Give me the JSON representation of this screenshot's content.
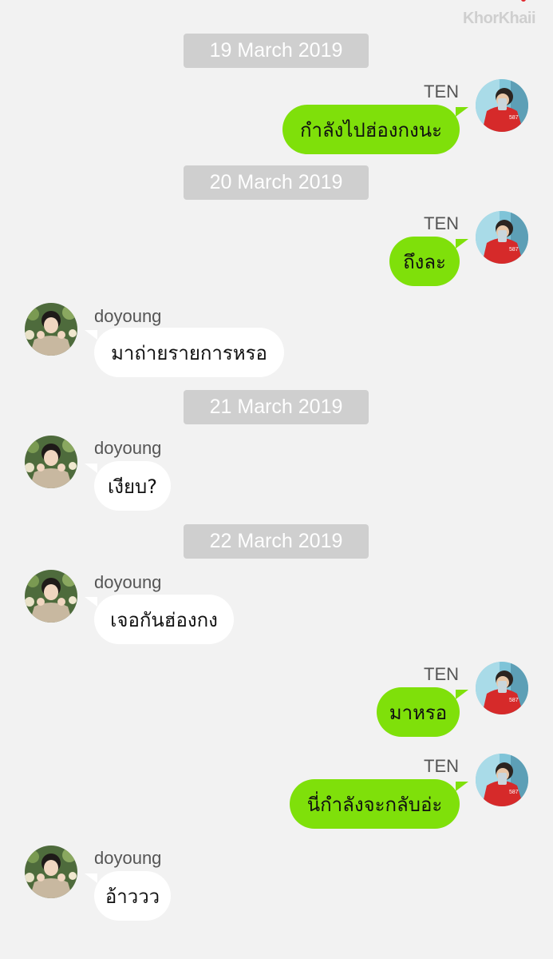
{
  "watermark": "KhorKhaii",
  "chat": {
    "dates": [
      "19 March 2019",
      "20 March 2019",
      "21 March 2019",
      "22 March 2019"
    ],
    "senders": {
      "ten": "TEN",
      "doyoung": "doyoung"
    },
    "messages": [
      {
        "sender": "TEN",
        "text": "กำลังไปฮ่องกงนะ"
      },
      {
        "sender": "TEN",
        "text": "ถึงละ"
      },
      {
        "sender": "doyoung",
        "text": "มาถ่ายรายการหรอ"
      },
      {
        "sender": "doyoung",
        "text": "เงียบ?"
      },
      {
        "sender": "doyoung",
        "text": "เจอกันฮ่องกง"
      },
      {
        "sender": "TEN",
        "text": "มาหรอ"
      },
      {
        "sender": "TEN",
        "text": "นี่กำลังจะกลับอ่ะ"
      },
      {
        "sender": "doyoung",
        "text": "อ้าววว"
      }
    ]
  },
  "colors": {
    "outgoing_bubble": "#7fe00a",
    "incoming_bubble": "#ffffff",
    "background": "#f2f2f2",
    "date_chip": "#cfcfcf"
  }
}
